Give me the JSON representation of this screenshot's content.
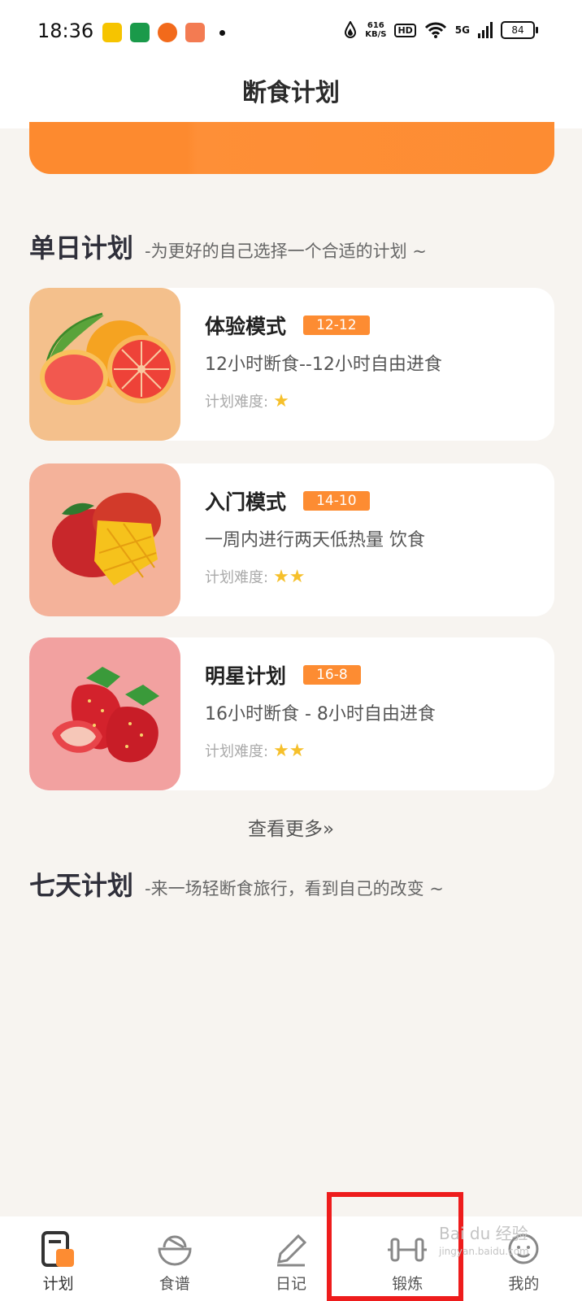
{
  "status_bar": {
    "time": "18:36",
    "net_speed_value": "616",
    "net_speed_unit": "KB/S",
    "hd": "HD",
    "signal": "5G",
    "battery": "84"
  },
  "header": {
    "title": "断食计划"
  },
  "single_day": {
    "title": "单日计划",
    "subtitle": "-为更好的自己选择一个合适的计划 ~"
  },
  "difficulty_label": "计划难度:",
  "plans": [
    {
      "name": "体验模式",
      "tag": "12-12",
      "desc": "12小时断食--12小时自由进食",
      "stars": 1,
      "stars_text": "★"
    },
    {
      "name": "入门模式",
      "tag": "14-10",
      "desc": "一周内进行两天低热量 饮食",
      "stars": 2,
      "stars_text": "★★"
    },
    {
      "name": "明星计划",
      "tag": "16-8",
      "desc": "16小时断食 - 8小时自由进食",
      "stars": 2,
      "stars_text": "★★"
    }
  ],
  "more_label": "查看更多»",
  "seven_day": {
    "title": "七天计划",
    "subtitle": "-来一场轻断食旅行，看到自己的改变 ~"
  },
  "nav": [
    {
      "label": "计划",
      "icon": "plan-icon",
      "active": true
    },
    {
      "label": "食谱",
      "icon": "bowl-icon",
      "active": false
    },
    {
      "label": "日记",
      "icon": "pen-icon",
      "active": false
    },
    {
      "label": "锻炼",
      "icon": "dumbbell-icon",
      "active": false
    },
    {
      "label": "我的",
      "icon": "profile-icon",
      "active": false
    }
  ],
  "watermark": {
    "line1": "Bai du 经验",
    "line2": "jingyan.baidu.com"
  },
  "colors": {
    "accent": "#fd8c32",
    "star": "#f6c02b",
    "highlight_box": "#ee1c1c",
    "background": "#f7f4f0"
  }
}
